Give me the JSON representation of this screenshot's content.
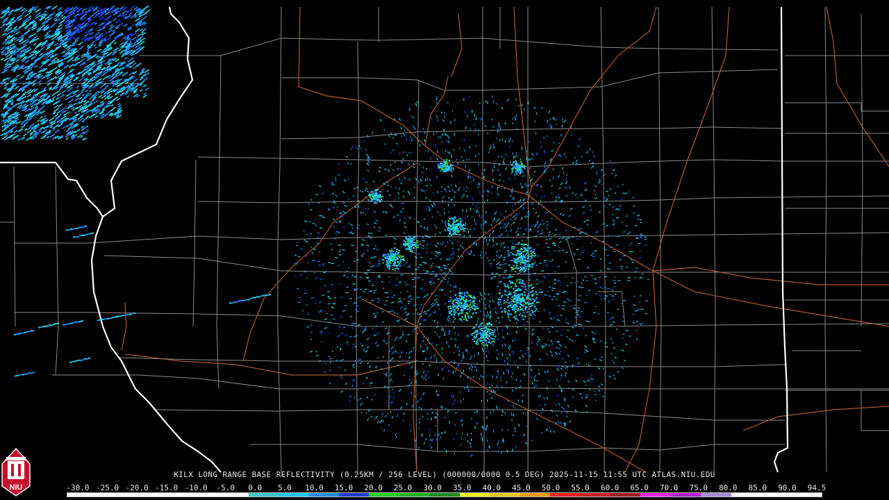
{
  "caption": {
    "text": "KILX LONG RANGE BASE REFLECTIVITY (0.25KM / 256 LEVEL) (000000/0000 0.5 DEG) 2025-11-15 11:55 UTC  ATLAS.NIU.EDU"
  },
  "legend": {
    "labels": [
      "-30.0",
      "-25.0",
      "-20.0",
      "-15.0",
      "-10.0",
      "-5.0",
      "0.0",
      "5.0",
      "10.0",
      "15.0",
      "20.0",
      "25.0",
      "30.0",
      "35.0",
      "40.0",
      "45.0",
      "50.0",
      "55.0",
      "60.0",
      "65.0",
      "70.0",
      "75.0",
      "80.0",
      "85.0",
      "90.0",
      "94.5"
    ],
    "colors": [
      "#ffffff",
      "#ffffff",
      "#ffffff",
      "#ffffff",
      "#ffffff",
      "#ffffff",
      "#39c8c8",
      "#1ec8f0",
      "#1e8cf0",
      "#1e3cdc",
      "#1ed21e",
      "#1eb41e",
      "#1e8c1e",
      "#f0f01e",
      "#e6c81e",
      "#f09600",
      "#f01e1e",
      "#c81e1e",
      "#a01e1e",
      "#f01ef0",
      "#b41edc",
      "#a08cd2",
      "#ffffff",
      "#ffffff",
      "#ffffff"
    ]
  },
  "map": {
    "colors": {
      "background": "#000000",
      "state_border": "#ffffff",
      "county_line": "#8a8a8a",
      "highway": "#b05a32",
      "echo_light": "#2ad2e6",
      "echo_mid": "#1e8cf0",
      "echo_dark": "#1e3cdc",
      "echo_green": "#2ad21e"
    },
    "icons": [
      "niu-logo-icon"
    ]
  },
  "logo": {
    "text": "NIU"
  }
}
